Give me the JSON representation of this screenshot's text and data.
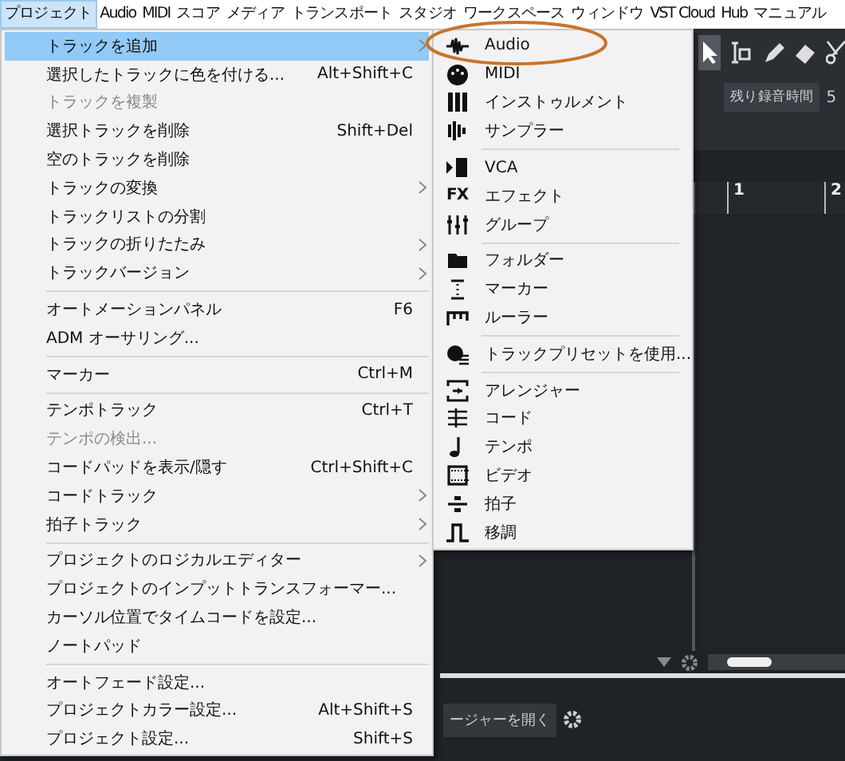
{
  "menubar": [
    {
      "label": "プロジェクト",
      "selected": true
    },
    {
      "label": "Audio",
      "selected": false
    },
    {
      "label": "MIDI",
      "selected": false
    },
    {
      "label": "スコア",
      "selected": false
    },
    {
      "label": "メディア",
      "selected": false
    },
    {
      "label": "トランスポート",
      "selected": false
    },
    {
      "label": "スタジオ",
      "selected": false
    },
    {
      "label": "ワークスペース",
      "selected": false
    },
    {
      "label": "ウィンドウ",
      "selected": false
    },
    {
      "label": "VST Cloud",
      "selected": false
    },
    {
      "label": "Hub",
      "selected": false
    },
    {
      "label": "マニュアル",
      "selected": false
    }
  ],
  "project_menu": {
    "groups": [
      [
        {
          "label": "トラックを追加",
          "highlighted": true,
          "disabled": false,
          "submenu": true
        },
        {
          "label": "選択したトラックに色を付ける...",
          "highlighted": false,
          "disabled": false,
          "submenu": false,
          "shortcut": "Alt+Shift+C"
        },
        {
          "label": "トラックを複製",
          "highlighted": false,
          "disabled": true,
          "submenu": false
        },
        {
          "label": "選択トラックを削除",
          "highlighted": false,
          "disabled": false,
          "submenu": false,
          "shortcut": "Shift+Del"
        },
        {
          "label": "空のトラックを削除",
          "highlighted": false,
          "disabled": false,
          "submenu": false
        },
        {
          "label": "トラックの変換",
          "highlighted": false,
          "disabled": false,
          "submenu": true
        },
        {
          "label": "トラックリストの分割",
          "highlighted": false,
          "disabled": false,
          "submenu": false
        },
        {
          "label": "トラックの折りたたみ",
          "highlighted": false,
          "disabled": false,
          "submenu": true
        },
        {
          "label": "トラックバージョン",
          "highlighted": false,
          "disabled": false,
          "submenu": true
        }
      ],
      [
        {
          "label": "オートメーションパネル",
          "highlighted": false,
          "disabled": false,
          "submenu": false,
          "shortcut": "F6"
        },
        {
          "label": "ADM オーサリング...",
          "highlighted": false,
          "disabled": false,
          "submenu": false
        }
      ],
      [
        {
          "label": "マーカー",
          "highlighted": false,
          "disabled": false,
          "submenu": false,
          "shortcut": "Ctrl+M"
        }
      ],
      [
        {
          "label": "テンポトラック",
          "highlighted": false,
          "disabled": false,
          "submenu": false,
          "shortcut": "Ctrl+T"
        },
        {
          "label": "テンポの検出...",
          "highlighted": false,
          "disabled": true,
          "submenu": false
        },
        {
          "label": "コードパッドを表示/隠す",
          "highlighted": false,
          "disabled": false,
          "submenu": false,
          "shortcut": "Ctrl+Shift+C"
        },
        {
          "label": "コードトラック",
          "highlighted": false,
          "disabled": false,
          "submenu": true
        },
        {
          "label": "拍子トラック",
          "highlighted": false,
          "disabled": false,
          "submenu": true
        }
      ],
      [
        {
          "label": "プロジェクトのロジカルエディター",
          "highlighted": false,
          "disabled": false,
          "submenu": true
        },
        {
          "label": "プロジェクトのインプットトランスフォーマー...",
          "highlighted": false,
          "disabled": false,
          "submenu": false
        },
        {
          "label": "カーソル位置でタイムコードを設定...",
          "highlighted": false,
          "disabled": false,
          "submenu": false
        },
        {
          "label": "ノートパッド",
          "highlighted": false,
          "disabled": false,
          "submenu": false
        }
      ],
      [
        {
          "label": "オートフェード設定...",
          "highlighted": false,
          "disabled": false,
          "submenu": false
        },
        {
          "label": "プロジェクトカラー設定...",
          "highlighted": false,
          "disabled": false,
          "submenu": false,
          "shortcut": "Alt+Shift+S"
        },
        {
          "label": "プロジェクト設定...",
          "highlighted": false,
          "disabled": false,
          "submenu": false,
          "shortcut": "Shift+S"
        }
      ]
    ]
  },
  "add_track_submenu": {
    "groups": [
      [
        {
          "label": "Audio"
        },
        {
          "label": "MIDI"
        },
        {
          "label": "インストゥルメント"
        },
        {
          "label": "サンプラー"
        }
      ],
      [
        {
          "label": "VCA"
        },
        {
          "label": "エフェクト",
          "glyph": "FX"
        },
        {
          "label": "グループ"
        }
      ],
      [
        {
          "label": "フォルダー"
        },
        {
          "label": "マーカー"
        },
        {
          "label": "ルーラー"
        }
      ],
      [
        {
          "label": "トラックプリセットを使用..."
        }
      ],
      [
        {
          "label": "アレンジャー"
        },
        {
          "label": "コード"
        },
        {
          "label": "テンポ"
        },
        {
          "label": "ビデオ"
        },
        {
          "label": "拍子"
        },
        {
          "label": "移調"
        }
      ]
    ]
  },
  "toolbar": {
    "record_time_button": "残り録音時間",
    "cut_value": "5"
  },
  "ruler": [
    "1",
    "2"
  ],
  "lower_zone": {
    "button": "ージャーを開く"
  }
}
